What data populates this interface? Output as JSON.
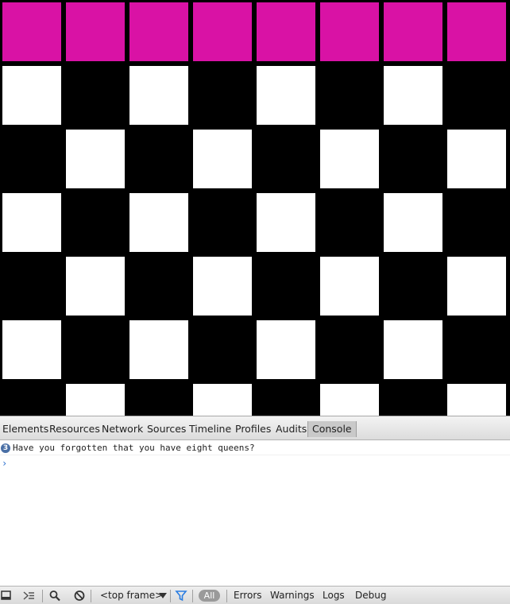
{
  "board": {
    "queen_color": "#d912a5",
    "light_color": "#ffffff",
    "dark_color": "#000000",
    "queen_row": 0,
    "columns": 8
  },
  "devtools": {
    "tabs": [
      "Elements",
      "Resources",
      "Network",
      "Sources",
      "Timeline",
      "Profiles",
      "Audits",
      "Console"
    ],
    "active_tab": "Console"
  },
  "console": {
    "message_count": "3",
    "message": "Have you forgotten that you have eight queens?",
    "prompt": "›"
  },
  "statusbar": {
    "frame_selector": "<top frame>",
    "filter_all": "All",
    "filters": [
      "Errors",
      "Warnings",
      "Logs",
      "Debug"
    ],
    "icons": [
      "dock-icon",
      "show-drawer-icon",
      "search-icon",
      "clear-console-icon",
      "filter-icon"
    ]
  }
}
